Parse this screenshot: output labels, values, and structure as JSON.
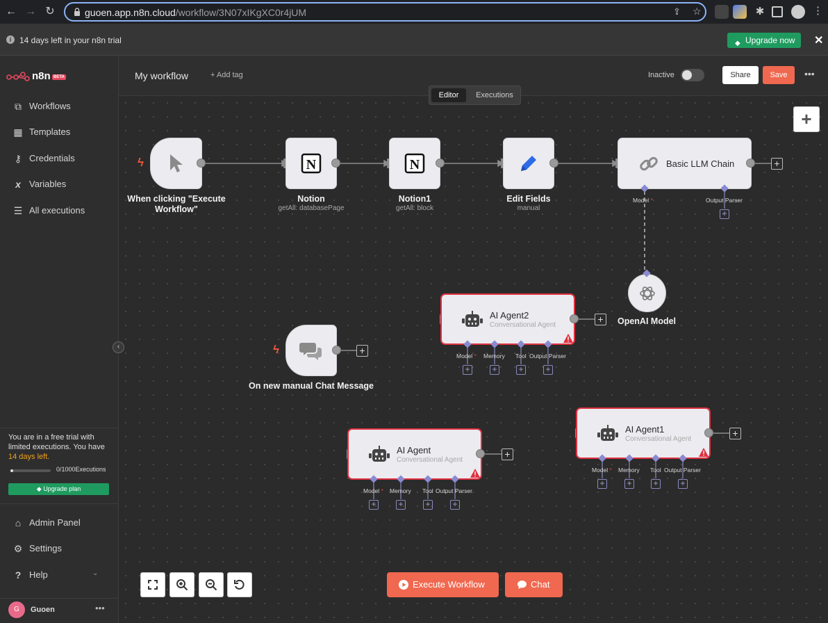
{
  "browser": {
    "url_host": "guoen.app.n8n.cloud",
    "url_path": "/workflow/3N07xIKgXC0r4jUM"
  },
  "banner": {
    "message": "14 days left in your n8n trial",
    "upgrade_label": "Upgrade now",
    "close_label": "✕"
  },
  "sidebar": {
    "logo_text": "n8n",
    "beta_badge": "BETA",
    "items": [
      {
        "label": "Workflows",
        "icon": "workflows-icon"
      },
      {
        "label": "Templates",
        "icon": "templates-icon"
      },
      {
        "label": "Credentials",
        "icon": "key-icon"
      },
      {
        "label": "Variables",
        "icon": "variables-icon"
      },
      {
        "label": "All executions",
        "icon": "list-icon"
      }
    ],
    "trial": {
      "text_before": "You are in a free trial with limited executions. You have",
      "days": "14 days left.",
      "count_used": "0",
      "count_total": "/1000Executions",
      "progress": 0,
      "upgrade_label": "Upgrade plan"
    },
    "bottom_items": [
      {
        "label": "Admin Panel",
        "icon": "home-icon"
      },
      {
        "label": "Settings",
        "icon": "gear-icon"
      },
      {
        "label": "Help",
        "icon": "help-icon"
      }
    ],
    "user": {
      "initial": "G",
      "name": "Guoen"
    }
  },
  "header": {
    "workflow_name": "My workflow",
    "add_tag": "+ Add tag",
    "status_label": "Inactive",
    "share_label": "Share",
    "save_label": "Save",
    "tabs": {
      "editor": "Editor",
      "executions": "Executions"
    }
  },
  "nodes": {
    "manual_trigger": {
      "title": "When clicking \"Execute Workflow\""
    },
    "notion": {
      "title": "Notion",
      "sub": "getAll: databasePage"
    },
    "notion1": {
      "title": "Notion1",
      "sub": "getAll: block"
    },
    "edit_fields": {
      "title": "Edit Fields",
      "sub": "manual"
    },
    "llm_chain": {
      "title": "Basic LLM Chain",
      "slots": {
        "model": "Model",
        "output_parser": "Output Parser"
      }
    },
    "openai_model": {
      "title": "OpenAI Model"
    },
    "chat_trigger": {
      "title": "On new manual Chat Message"
    },
    "ai_agent2": {
      "title": "AI Agent2",
      "sub": "Conversational Agent"
    },
    "ai_agent": {
      "title": "AI Agent",
      "sub": "Conversational Agent"
    },
    "ai_agent1": {
      "title": "AI Agent1",
      "sub": "Conversational Agent"
    },
    "agent_slots": {
      "model": "Model",
      "memory": "Memory",
      "tool": "Tool",
      "output_parser": "Output Parser",
      "required": "*"
    }
  },
  "controls": {
    "execute_label": "Execute Workflow",
    "chat_label": "Chat"
  }
}
